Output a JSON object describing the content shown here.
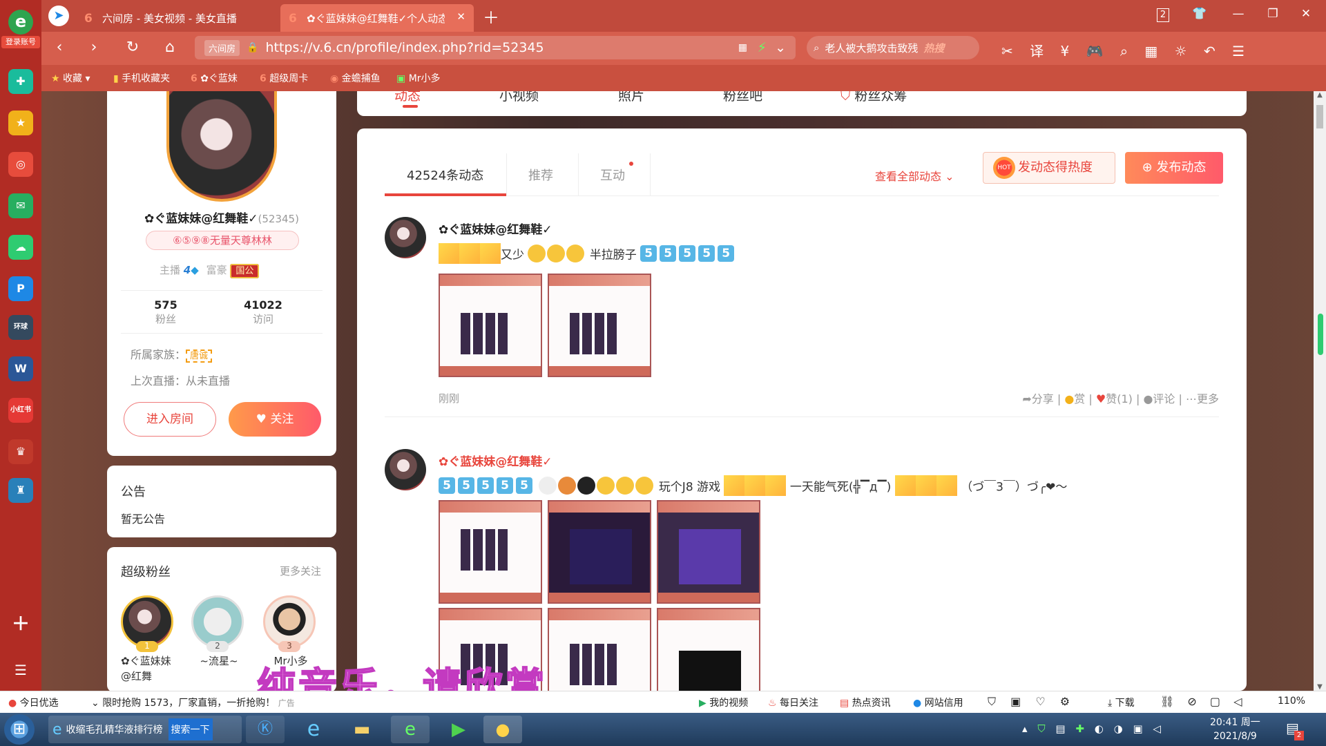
{
  "browser": {
    "tabs": [
      {
        "label": "六间房 - 美女视频 - 美女直播",
        "fav": "6"
      },
      {
        "label": "✿ぐ蓝妹妹@红舞鞋✓个人动态",
        "fav": "6"
      }
    ],
    "tab_count": "2",
    "url": "https://v.6.cn/profile/index.php?rid=52345",
    "url_prefix": "六间房",
    "search_text": "老人被大鹅攻击致残",
    "search_badge": "热搜",
    "login_label": "登录账号"
  },
  "bookmarks": [
    {
      "label": "收藏"
    },
    {
      "label": "手机收藏夹"
    },
    {
      "label": "✿ぐ蓝妹"
    },
    {
      "label": "超级周卡"
    },
    {
      "label": "金蟾捕鱼"
    },
    {
      "label": "Mr小多"
    }
  ],
  "profile": {
    "name": "✿ぐ蓝妹妹@红舞鞋✓",
    "rid": "(52345)",
    "title_badge": "⑥⑤⑨⑧无量天尊林林",
    "anchor_label": "主播",
    "anchor_level": "4",
    "rich_label": "富豪",
    "rich_badge": "国公",
    "fans_count": "575",
    "fans_label": "粉丝",
    "visit_count": "41022",
    "visit_label": "访问",
    "family_label": "所属家族：",
    "family_value": "唐诚",
    "last_live": "上次直播：从未直播",
    "enter_room": "进入房间",
    "follow": "关注"
  },
  "notice": {
    "title": "公告",
    "body": "暂无公告"
  },
  "superfans": {
    "title": "超级粉丝",
    "more": "更多关注",
    "items": [
      {
        "rank": "1",
        "name": "✿ぐ蓝妹妹@红舞"
      },
      {
        "rank": "2",
        "name": "~流星~"
      },
      {
        "rank": "3",
        "name": "Mr小多"
      }
    ]
  },
  "topnav": [
    "动态",
    "小视频",
    "照片",
    "粉丝吧",
    "粉丝众筹"
  ],
  "feed": {
    "tabs": [
      "42524条动态",
      "推荐",
      "互动"
    ],
    "view_all": "查看全部动态",
    "hot_btn": "发动态得热度",
    "publish_btn": "发布动态",
    "posts": [
      {
        "author": "✿ぐ蓝妹妹@红舞鞋✓",
        "text1": "又少",
        "text2": "半拉膀子",
        "time": "刚刚",
        "actions": {
          "share": "分享",
          "reward": "赏",
          "like": "赞(1)",
          "comment": "评论",
          "more": "更多"
        }
      },
      {
        "author": "✿ぐ蓝妹妹@红舞鞋✓",
        "text1": "玩个J8 游戏",
        "text2": "一天能气死(╬▔д▔)",
        "text3": "（づ￣3￣）づ╭❤～"
      }
    ]
  },
  "watermark": "纯音乐，请欣赏",
  "statusbar": {
    "left": "今日优选",
    "ad": "限时抢购 1573，厂家直销，一折抢购！",
    "ad_tag": "广告",
    "items": [
      "我的视频",
      "每日关注",
      "热点资讯",
      "网站信用"
    ],
    "download": "下载",
    "zoom": "110%"
  },
  "taskbar": {
    "ie_task": "收缩毛孔精华液排行榜",
    "search_btn": "搜索一下",
    "time": "20:41 周一",
    "date": "2021/8/9",
    "notif_count": "2"
  },
  "colors": {
    "accent": "#ff5a5f",
    "brand": "#ff6b4a",
    "tabbar": "#c04a3c"
  }
}
